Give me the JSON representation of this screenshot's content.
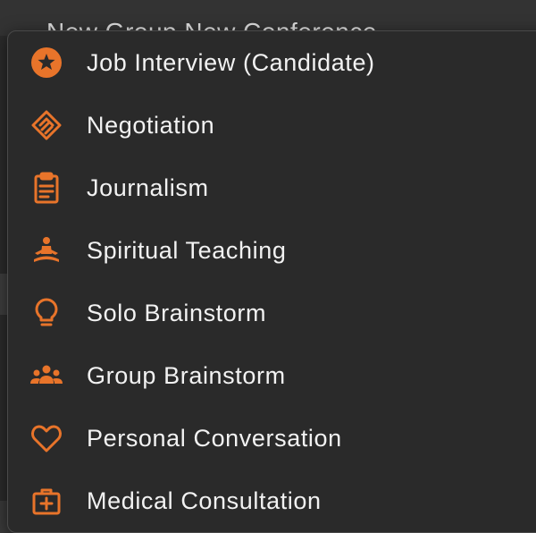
{
  "background": {
    "partial_title": "New Group New Conference"
  },
  "colors": {
    "accent": "#e8742a",
    "menu_bg": "#2a2a2a",
    "text": "#f2f2f2"
  },
  "menu": {
    "items": [
      {
        "label": "Job Interview (Candidate)",
        "icon": "star-badge-icon"
      },
      {
        "label": "Negotiation",
        "icon": "handshake-icon"
      },
      {
        "label": "Journalism",
        "icon": "clipboard-icon"
      },
      {
        "label": "Spiritual Teaching",
        "icon": "meditation-icon"
      },
      {
        "label": "Solo Brainstorm",
        "icon": "lightbulb-icon"
      },
      {
        "label": "Group Brainstorm",
        "icon": "group-icon"
      },
      {
        "label": "Personal Conversation",
        "icon": "heart-icon"
      },
      {
        "label": "Medical Consultation",
        "icon": "medical-kit-icon"
      }
    ]
  }
}
